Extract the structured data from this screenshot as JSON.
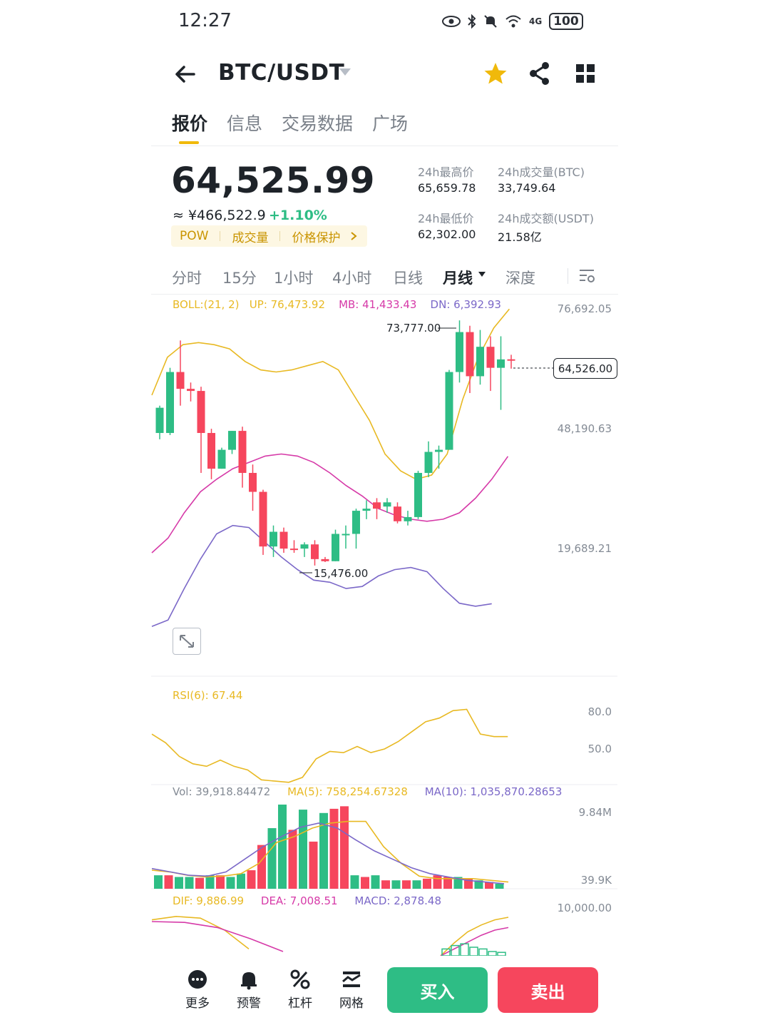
{
  "status_bar": {
    "time": "12:27",
    "network": "4G",
    "battery": "100"
  },
  "header": {
    "pair": "BTC/USDT"
  },
  "tabs": [
    {
      "label": "报价",
      "active": true
    },
    {
      "label": "信息",
      "active": false
    },
    {
      "label": "交易数据",
      "active": false
    },
    {
      "label": "广场",
      "active": false
    }
  ],
  "ticker": {
    "price": "64,525.99",
    "cny": "≈ ¥466,522.9",
    "change": "+1.10%",
    "tags": [
      "POW",
      "成交量",
      "价格保护"
    ],
    "high_label": "24h最高价",
    "high_value": "65,659.78",
    "low_label": "24h最低价",
    "low_value": "62,302.00",
    "vol_btc_label": "24h成交量(BTC)",
    "vol_btc_value": "33,749.64",
    "vol_usdt_label": "24h成交额(USDT)",
    "vol_usdt_value": "21.58亿"
  },
  "intervals": [
    {
      "label": "分时",
      "active": false
    },
    {
      "label": "15分",
      "active": false
    },
    {
      "label": "1小时",
      "active": false
    },
    {
      "label": "4小时",
      "active": false
    },
    {
      "label": "日线",
      "active": false
    },
    {
      "label": "月线",
      "active": true
    },
    {
      "label": "深度",
      "active": false
    }
  ],
  "boll": {
    "label": "BOLL:(21, 2)",
    "up": "UP: 76,473.92",
    "mb": "MB: 41,433.43",
    "dn": "DN: 6,392.93"
  },
  "price_axis": [
    "76,692.05",
    "48,190.63",
    "19,689.21"
  ],
  "current_price_tag": "64,526.00",
  "annot_high": "73,777.00",
  "annot_low": "15,476.00",
  "rsi": {
    "label": "RSI(6): 67.44",
    "axis": [
      "80.0",
      "50.0"
    ]
  },
  "volume": {
    "vol": "Vol: 39,918.84472",
    "ma5": "MA(5): 758,254.67328",
    "ma10": "MA(10): 1,035,870.28653",
    "axis": [
      "9.84M",
      "39.9K"
    ]
  },
  "macd": {
    "dif": "DIF: 9,886.99",
    "dea": "DEA: 7,008.51",
    "macd": "MACD: 2,878.48",
    "axis": [
      "10,000.00"
    ]
  },
  "colors": {
    "up": "#2ebd85",
    "down": "#f6465d",
    "boll_up": "#e8b923",
    "boll_mb": "#d63aa8",
    "boll_dn": "#7b68c8",
    "accent": "#f0b90b"
  },
  "chart_data": {
    "type": "candlestick",
    "title": "",
    "ylabel": "",
    "ylim": [
      15000,
      80000
    ],
    "candles": [
      {
        "o": 53000,
        "h": 53500,
        "l": 45500,
        "c": 47000,
        "up": true
      },
      {
        "o": 47000,
        "h": 62500,
        "l": 46500,
        "c": 61500,
        "up": true
      },
      {
        "o": 61500,
        "h": 69000,
        "l": 53500,
        "c": 57500,
        "up": false
      },
      {
        "o": 57500,
        "h": 59000,
        "l": 54500,
        "c": 57000,
        "up": false
      },
      {
        "o": 57000,
        "h": 58000,
        "l": 37500,
        "c": 47000,
        "up": false
      },
      {
        "o": 47000,
        "h": 48000,
        "l": 36000,
        "c": 38500,
        "up": false
      },
      {
        "o": 38500,
        "h": 43500,
        "l": 38500,
        "c": 43000,
        "up": true
      },
      {
        "o": 43000,
        "h": 47500,
        "l": 42000,
        "c": 47500,
        "up": true
      },
      {
        "o": 47500,
        "h": 48500,
        "l": 34000,
        "c": 37500,
        "up": false
      },
      {
        "o": 37500,
        "h": 39500,
        "l": 28500,
        "c": 33000,
        "up": false
      },
      {
        "o": 33000,
        "h": 33500,
        "l": 18000,
        "c": 20000,
        "up": false
      },
      {
        "o": 20000,
        "h": 25000,
        "l": 17500,
        "c": 23500,
        "up": true
      },
      {
        "o": 23500,
        "h": 24500,
        "l": 18500,
        "c": 19500,
        "up": false
      },
      {
        "o": 19500,
        "h": 21500,
        "l": 18500,
        "c": 19500,
        "up": false
      },
      {
        "o": 19500,
        "h": 21000,
        "l": 17500,
        "c": 20500,
        "up": true
      },
      {
        "o": 20500,
        "h": 21500,
        "l": 15476,
        "c": 17000,
        "up": false
      },
      {
        "o": 17000,
        "h": 17500,
        "l": 16300,
        "c": 16500,
        "up": false
      },
      {
        "o": 16500,
        "h": 24000,
        "l": 16500,
        "c": 23000,
        "up": true
      },
      {
        "o": 23000,
        "h": 25000,
        "l": 19500,
        "c": 23000,
        "up": true
      },
      {
        "o": 23000,
        "h": 29000,
        "l": 19500,
        "c": 28500,
        "up": true
      },
      {
        "o": 28500,
        "h": 31000,
        "l": 26500,
        "c": 29000,
        "up": true
      },
      {
        "o": 29000,
        "h": 31500,
        "l": 26500,
        "c": 30500,
        "up": false
      },
      {
        "o": 30500,
        "h": 31500,
        "l": 28000,
        "c": 29500,
        "up": true
      },
      {
        "o": 29500,
        "h": 30500,
        "l": 25500,
        "c": 26000,
        "up": false
      },
      {
        "o": 26000,
        "h": 28500,
        "l": 25000,
        "c": 27000,
        "up": true
      },
      {
        "o": 27000,
        "h": 38000,
        "l": 26500,
        "c": 37500,
        "up": true
      },
      {
        "o": 37500,
        "h": 45000,
        "l": 36500,
        "c": 42500,
        "up": true
      },
      {
        "o": 42500,
        "h": 44000,
        "l": 38500,
        "c": 43000,
        "up": true
      },
      {
        "o": 43000,
        "h": 62000,
        "l": 43000,
        "c": 61500,
        "up": true
      },
      {
        "o": 61500,
        "h": 73777,
        "l": 59000,
        "c": 71000,
        "up": true
      },
      {
        "o": 71000,
        "h": 72500,
        "l": 56500,
        "c": 60500,
        "up": false
      },
      {
        "o": 60500,
        "h": 71500,
        "l": 58500,
        "c": 67500,
        "up": true
      },
      {
        "o": 67500,
        "h": 70000,
        "l": 57000,
        "c": 62500,
        "up": false
      },
      {
        "o": 62500,
        "h": 70000,
        "l": 52500,
        "c": 64500,
        "up": true
      },
      {
        "o": 64500,
        "h": 65600,
        "l": 62300,
        "c": 64526,
        "up": false
      }
    ],
    "boll_upper": [
      56000,
      65000,
      68000,
      68500,
      68000,
      67000,
      64000,
      62000,
      61500,
      62000,
      63000,
      64000,
      62000,
      56000,
      50000,
      42000,
      38000,
      36000,
      37000,
      42000,
      55000,
      65000,
      72000,
      76473
    ],
    "boll_middle": [
      18500,
      22000,
      28000,
      33000,
      36000,
      38500,
      40000,
      41500,
      42000,
      41500,
      40000,
      37500,
      34500,
      32000,
      29000,
      27500,
      26500,
      26000,
      26500,
      28000,
      31500,
      36000,
      41433
    ],
    "boll_lower": [
      1000,
      2500,
      10000,
      17000,
      23000,
      25000,
      24500,
      21000,
      17500,
      14500,
      12000,
      11500,
      10000,
      10500,
      13000,
      14500,
      15000,
      14000,
      10000,
      6500,
      5800,
      6393
    ],
    "rsi": [
      62,
      55,
      44,
      38,
      36,
      41,
      36,
      33,
      25,
      24,
      23,
      27,
      42,
      48,
      47,
      52,
      47,
      50,
      56,
      64,
      72,
      75,
      81,
      82,
      62,
      60,
      60
    ],
    "volume_bars": [
      {
        "v": 0.16,
        "up": true
      },
      {
        "v": 0.16,
        "up": false
      },
      {
        "v": 0.14,
        "up": true
      },
      {
        "v": 0.14,
        "up": true
      },
      {
        "v": 0.13,
        "up": false
      },
      {
        "v": 0.16,
        "up": true
      },
      {
        "v": 0.16,
        "up": false
      },
      {
        "v": 0.14,
        "up": true
      },
      {
        "v": 0.18,
        "up": true
      },
      {
        "v": 0.22,
        "up": false
      },
      {
        "v": 0.52,
        "up": false
      },
      {
        "v": 0.72,
        "up": true
      },
      {
        "v": 1.0,
        "up": true
      },
      {
        "v": 0.7,
        "up": false
      },
      {
        "v": 0.94,
        "up": true
      },
      {
        "v": 0.56,
        "up": false
      },
      {
        "v": 0.9,
        "up": true
      },
      {
        "v": 0.95,
        "up": false
      },
      {
        "v": 0.98,
        "up": false
      },
      {
        "v": 0.16,
        "up": true
      },
      {
        "v": 0.14,
        "up": false
      },
      {
        "v": 0.16,
        "up": true
      },
      {
        "v": 0.1,
        "up": false
      },
      {
        "v": 0.1,
        "up": true
      },
      {
        "v": 0.1,
        "up": false
      },
      {
        "v": 0.1,
        "up": true
      },
      {
        "v": 0.12,
        "up": false
      },
      {
        "v": 0.16,
        "up": false
      },
      {
        "v": 0.14,
        "up": false
      },
      {
        "v": 0.14,
        "up": true
      },
      {
        "v": 0.12,
        "up": false
      },
      {
        "v": 0.1,
        "up": true
      },
      {
        "v": 0.08,
        "up": false
      },
      {
        "v": 0.06,
        "up": true
      }
    ],
    "macd_dif": [
      0.42,
      0.46,
      0.44,
      0.3,
      0.08
    ],
    "macd_dea": [
      0.4,
      0.39,
      0.33,
      0.2,
      0.05
    ]
  }
}
